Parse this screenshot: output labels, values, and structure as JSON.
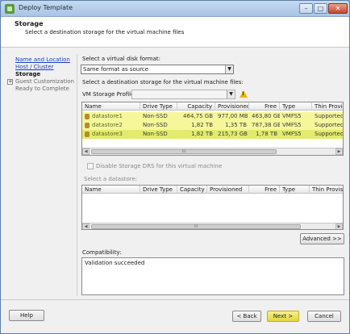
{
  "window": {
    "title": "Deploy Template",
    "controls": {
      "minimize": "–",
      "maximize": "□",
      "close": "✕"
    }
  },
  "header": {
    "title": "Storage",
    "subtitle": "Select a destination storage for the virtual machine files"
  },
  "nav": {
    "items": [
      {
        "label": "Name and Location",
        "state": "link"
      },
      {
        "label": "Host / Cluster",
        "state": "link"
      },
      {
        "label": "Storage",
        "state": "current"
      },
      {
        "label": "Guest Customization",
        "state": "muted",
        "expand": "+"
      },
      {
        "label": "Ready to Complete",
        "state": "muted"
      }
    ]
  },
  "disk_format": {
    "label": "Select a virtual disk format:",
    "value": "Same format as source"
  },
  "dest_label": "Select a destination storage for the virtual machine files:",
  "profile": {
    "label": "VM Storage Profile:",
    "value": "",
    "warning_glyph": "!"
  },
  "storage_table": {
    "columns": [
      "Name",
      "Drive Type",
      "Capacity",
      "Provisioned",
      "Free",
      "Type",
      "Thin Provisi"
    ],
    "rows": [
      {
        "name": "datastore1",
        "drive": "Non-SSD",
        "capacity": "464,75 GB",
        "provisioned": "977,00 MB",
        "free": "463,80 GB",
        "type": "VMFS5",
        "thin": "Supported"
      },
      {
        "name": "datastore2",
        "drive": "Non-SSD",
        "capacity": "1,82 TB",
        "provisioned": "1,35 TB",
        "free": "787,38 GB",
        "type": "VMFS5",
        "thin": "Supported"
      },
      {
        "name": "datastore3",
        "drive": "Non-SSD",
        "capacity": "1,82 TB",
        "provisioned": "215,73 GB",
        "free": "1,78 TB",
        "type": "VMFS5",
        "thin": "Supported"
      }
    ],
    "scroll": {
      "left": "◀",
      "mid": "III",
      "right": "▶"
    }
  },
  "disable_drs": {
    "label": "Disable Storage DRS for this virtual machine",
    "checked": false
  },
  "datastore_label": "Select a datastore:",
  "datastore_table": {
    "columns": [
      "Name",
      "Drive Type",
      "Capacity",
      "Provisioned",
      "Free",
      "Type",
      "Thin Provisio"
    ],
    "scroll": {
      "left": "◀",
      "mid": "III",
      "right": "▶"
    }
  },
  "advanced_button": "Advanced >>",
  "compatibility": {
    "label": "Compatibility:",
    "value": "Validation succeeded"
  },
  "buttons": {
    "help": "Help",
    "back": "< Back",
    "next": "Next >",
    "cancel": "Cancel"
  }
}
